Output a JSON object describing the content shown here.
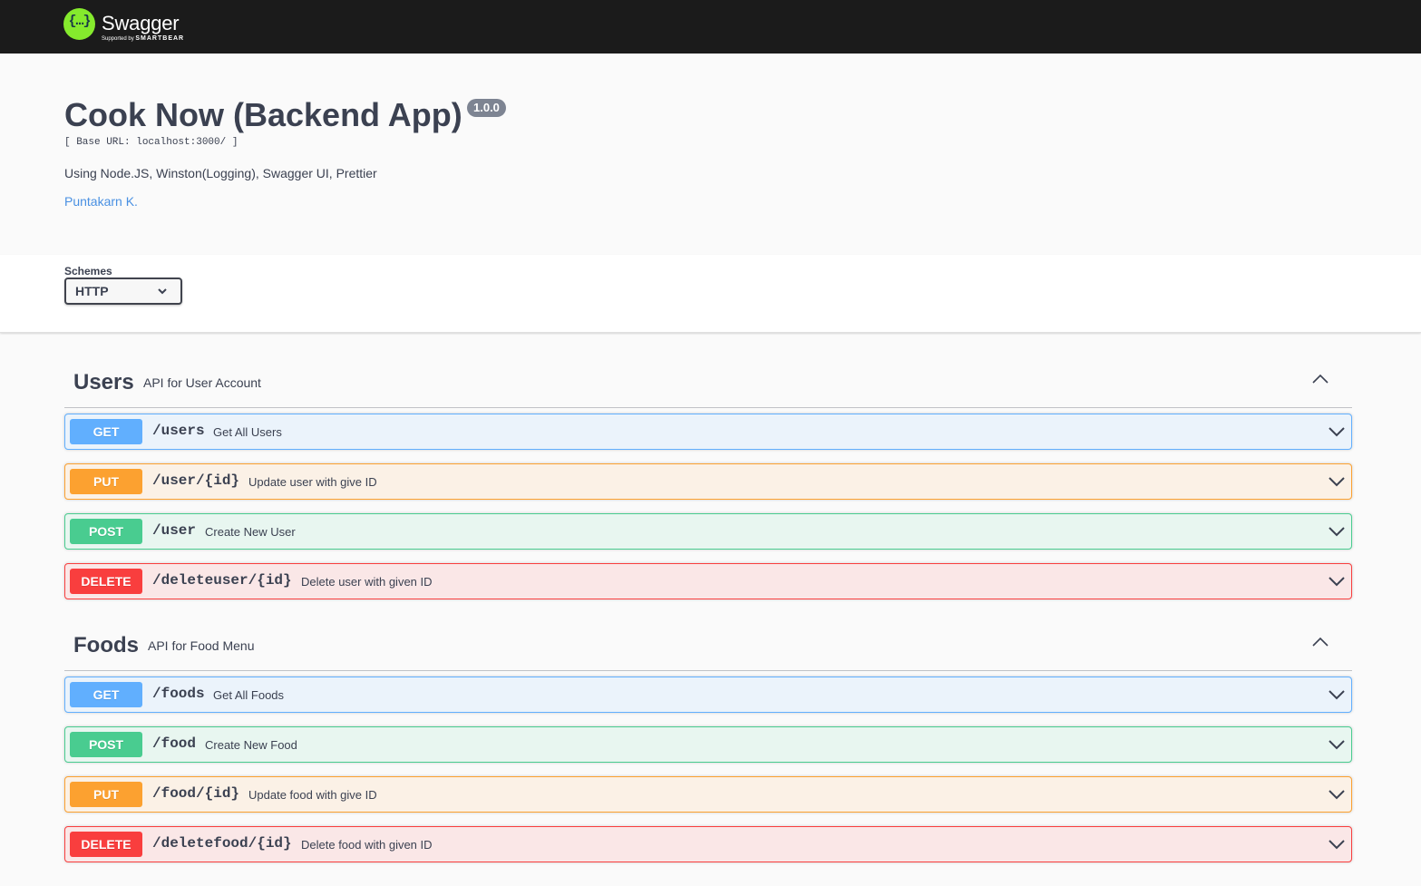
{
  "topbar": {
    "logo_name": "Swagger",
    "logo_sub_prefix": "Supported by",
    "logo_sub_brand": "SMARTBEAR",
    "logo_glyph": "{…}",
    "logo_color": "#85ea2d"
  },
  "info": {
    "title": "Cook Now (Backend App)",
    "version": "1.0.0",
    "base_url": "[ Base URL: localhost:3000/ ]",
    "description": "Using Node.JS, Winston(Logging), Swagger UI, Prettier",
    "contact": "Puntakarn K."
  },
  "schemes": {
    "label": "Schemes",
    "selected": "HTTP",
    "icon": "chevron-down-icon"
  },
  "method_colors": {
    "GET": "#61affe",
    "PUT": "#fca130",
    "POST": "#49cc90",
    "DELETE": "#f93e3e"
  },
  "tags": [
    {
      "name": "Users",
      "description": "API for User Account",
      "toggle_icon": "chevron-up-icon",
      "operations": [
        {
          "method": "GET",
          "path": "/users",
          "summary": "Get All Users"
        },
        {
          "method": "PUT",
          "path": "/user/{id}",
          "summary": "Update user with give ID"
        },
        {
          "method": "POST",
          "path": "/user",
          "summary": "Create New User"
        },
        {
          "method": "DELETE",
          "path": "/deleteuser/{id}",
          "summary": "Delete user with given ID"
        }
      ]
    },
    {
      "name": "Foods",
      "description": "API for Food Menu",
      "toggle_icon": "chevron-up-icon",
      "operations": [
        {
          "method": "GET",
          "path": "/foods",
          "summary": "Get All Foods"
        },
        {
          "method": "POST",
          "path": "/food",
          "summary": "Create New Food"
        },
        {
          "method": "PUT",
          "path": "/food/{id}",
          "summary": "Update food with give ID"
        },
        {
          "method": "DELETE",
          "path": "/deletefood/{id}",
          "summary": "Delete food with given ID"
        }
      ]
    }
  ]
}
